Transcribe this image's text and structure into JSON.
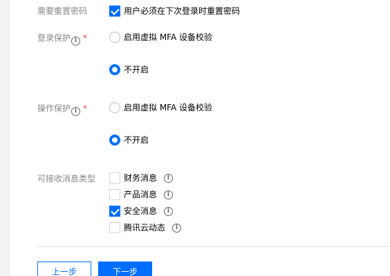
{
  "reset_password": {
    "label": "需要重置密码",
    "option": "用户必须在下次登录时重置密码",
    "checked": true
  },
  "login_protection": {
    "label": "登录保护",
    "required_mark": "*",
    "options": [
      {
        "label": "启用虚拟 MFA 设备校验",
        "selected": false
      },
      {
        "label": "不开启",
        "selected": true
      }
    ]
  },
  "operation_protection": {
    "label": "操作保护",
    "required_mark": "*",
    "options": [
      {
        "label": "启用虚拟 MFA 设备校验",
        "selected": false
      },
      {
        "label": "不开启",
        "selected": true
      }
    ]
  },
  "message_types": {
    "label": "可接收消息类型",
    "options": [
      {
        "label": "财务消息",
        "checked": false
      },
      {
        "label": "产品消息",
        "checked": false
      },
      {
        "label": "安全消息",
        "checked": true
      },
      {
        "label": "腾讯云动态",
        "checked": false
      }
    ]
  },
  "icons": {
    "info": "i"
  },
  "buttons": {
    "prev": "上一步",
    "next": "下一步"
  },
  "colors": {
    "accent": "#006eff",
    "required": "#e54545",
    "label": "#888888"
  }
}
